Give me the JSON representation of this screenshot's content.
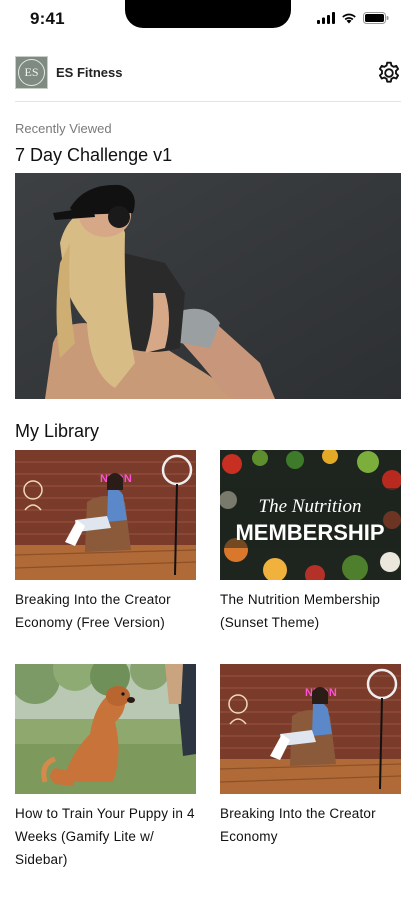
{
  "status_bar": {
    "time": "9:41"
  },
  "header": {
    "logo_text": "ES",
    "app_name": "ES Fitness"
  },
  "recently_viewed": {
    "caption": "Recently Viewed",
    "title": "7 Day Challenge v1"
  },
  "library": {
    "title": "My Library",
    "items": [
      {
        "title": "Breaking Into the Creator Economy (Free Version)"
      },
      {
        "title": "The Nutrition Membership (Sunset Theme)",
        "thumb_line1": "The Nutrition",
        "thumb_line2": "MEMBERSHIP"
      },
      {
        "title": "How to Train Your Puppy in 4 Weeks (Gamify Lite w/ Sidebar)"
      },
      {
        "title": "Breaking Into the Creator Economy"
      }
    ]
  },
  "colors": {
    "logo_bg": "#7f8a82",
    "hero_bg": "#3a3d40",
    "divider": "#e3e3e3"
  },
  "icons": [
    "signal-icon",
    "wifi-icon",
    "battery-icon",
    "gear-icon"
  ]
}
